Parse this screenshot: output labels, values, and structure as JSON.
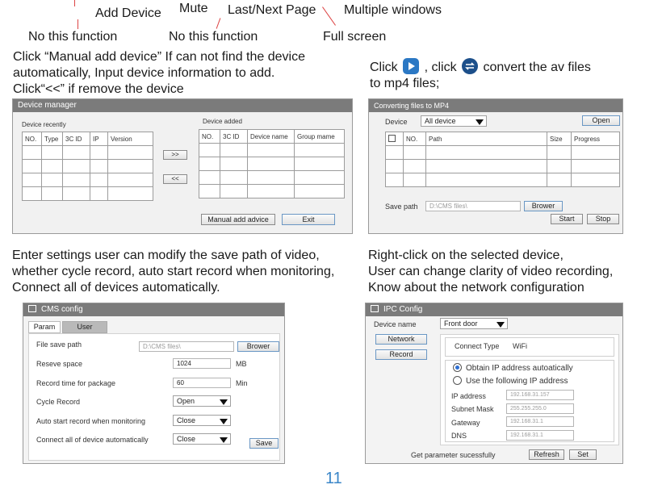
{
  "top_labels": {
    "add_device": "Add Device",
    "mute": "Mute",
    "last_next_page": "Last/Next Page",
    "multiple_windows": "Multiple windows",
    "no_function_1": "No this function",
    "no_function_2": "No this function",
    "full_screen": "Full screen"
  },
  "left_intro": {
    "line1": "Click “Manual add device” If can not find the device",
    "line2": "automatically, Input device information to add.",
    "line3": "Click“<<” if remove the device"
  },
  "right_intro": {
    "click1": "Click",
    "click2": ", click",
    "convert": "convert the av files",
    "line2": "to mp4 files;"
  },
  "device_manager": {
    "title": "Device manager",
    "recent_label": "Device recently",
    "added_label": "Device added",
    "recent_columns": [
      "NO.",
      "Type",
      "3C ID",
      "IP",
      "Version"
    ],
    "added_columns": [
      "NO.",
      "3C ID",
      "Device name",
      "Group mame"
    ],
    "add_btn": ">>",
    "remove_btn": "<<",
    "manual_add_btn": "Manual add advice",
    "exit_btn": "Exit"
  },
  "convert_window": {
    "title": "Converting files to MP4",
    "device_label": "Device",
    "device_value": "All device",
    "open_btn": "Open",
    "columns": [
      "NO.",
      "Path",
      "Size",
      "Progress"
    ],
    "save_path_label": "Save path",
    "save_path_value": "D:\\CMS files\\",
    "browse_btn": "Brower",
    "start_btn": "Start",
    "stop_btn": "Stop"
  },
  "settings_text": {
    "line1": "Enter settings user can modify the save path of video,",
    "line2": "whether cycle record, auto start record when monitoring,",
    "line3": "Connect all of devices automatically."
  },
  "rightclick_text": {
    "line1": "Right-click on the selected device,",
    "line2": "User can change clarity of video recording,",
    "line3": "Know about the network configuration"
  },
  "cms_config": {
    "title": "CMS config",
    "tab_param": "Param",
    "tab_user": "User",
    "file_save_path_label": "File save path",
    "file_save_path_value": "D:\\CMS files\\",
    "browse_btn": "Brower",
    "reserve_label": "Reseve space",
    "reserve_value": "1024",
    "reserve_unit": "MB",
    "record_time_label": "Record time  for package",
    "record_time_value": "60",
    "record_time_unit": "Min",
    "cycle_label": "Cycle Record",
    "cycle_value": "Open",
    "auto_start_label": "Auto start record when monitoring",
    "auto_start_value": "Close",
    "connect_all_label": "Connect all of device automatically",
    "connect_all_value": "Close",
    "save_btn": "Save"
  },
  "ipc_config": {
    "title": "IPC Config",
    "device_name_label": "Device name",
    "device_name_value": "Front door",
    "network_btn": "Network",
    "record_btn": "Record",
    "connect_type_label": "Connect Type",
    "connect_type_value": "WiFi",
    "radio_auto": "Obtain IP address autoatically",
    "radio_manual": "Use the following IP address",
    "ip_label": "IP address",
    "ip_value": "192.168.31.157",
    "mask_label": "Subnet Mask",
    "mask_value": "255.255.255.0",
    "gateway_label": "Gateway",
    "gateway_value": "192.168.31.1",
    "dns_label": "DNS",
    "dns_value": "192.168.31.1",
    "status_text": "Get parameter sucessfully",
    "refresh_btn": "Refresh",
    "set_btn": "Set"
  },
  "page_number": "11",
  "colors": {
    "window_titlebar": "#7b7b7b",
    "play_icon": "#2b78c4",
    "convert_icon": "#1c4f8a",
    "page_number": "#3a86c8",
    "leader_line": "#d44444"
  }
}
